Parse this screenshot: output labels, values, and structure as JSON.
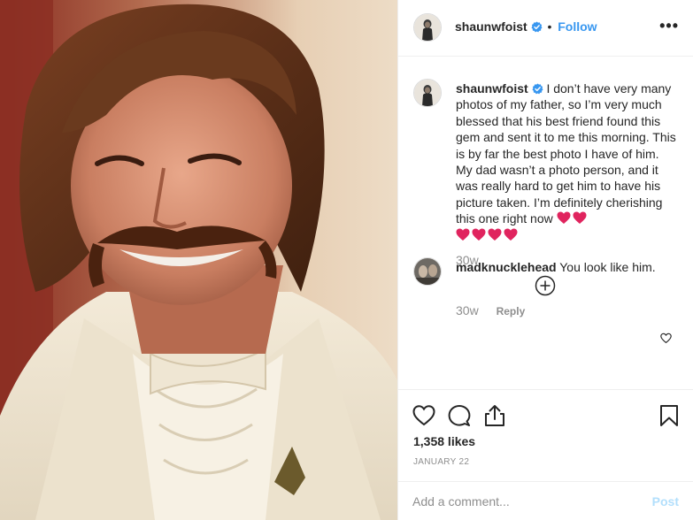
{
  "post": {
    "author": {
      "username": "shaunwfoist",
      "verified": true,
      "follow_label": "Follow",
      "separator": "•"
    },
    "more_options": "•••",
    "caption": {
      "text": "I don’t have very many photos of my father, so I’m very much blessed that his best friend found this gem and sent it to me this morning. This is by far the best photo I have of him. My dad wasn’t a photo person, and it was really hard to get him to have his picture taken. I’m definitely cherishing this one right now",
      "emoji": "red-heart x6",
      "time": "30w"
    },
    "comments": [
      {
        "username": "madknucklehead",
        "text": "You look like him.",
        "time": "30w",
        "reply_label": "Reply"
      }
    ],
    "likes_text": "1,358 likes",
    "date_text": "JANUARY 22",
    "comment_input": {
      "placeholder": "Add a comment...",
      "post_label": "Post"
    }
  },
  "colors": {
    "link_blue": "#3897f0",
    "verified_blue": "#3897f0",
    "text_gray": "#8e8e8e",
    "post_disabled": "#b2dffc",
    "heart_red": "#e0245e"
  }
}
